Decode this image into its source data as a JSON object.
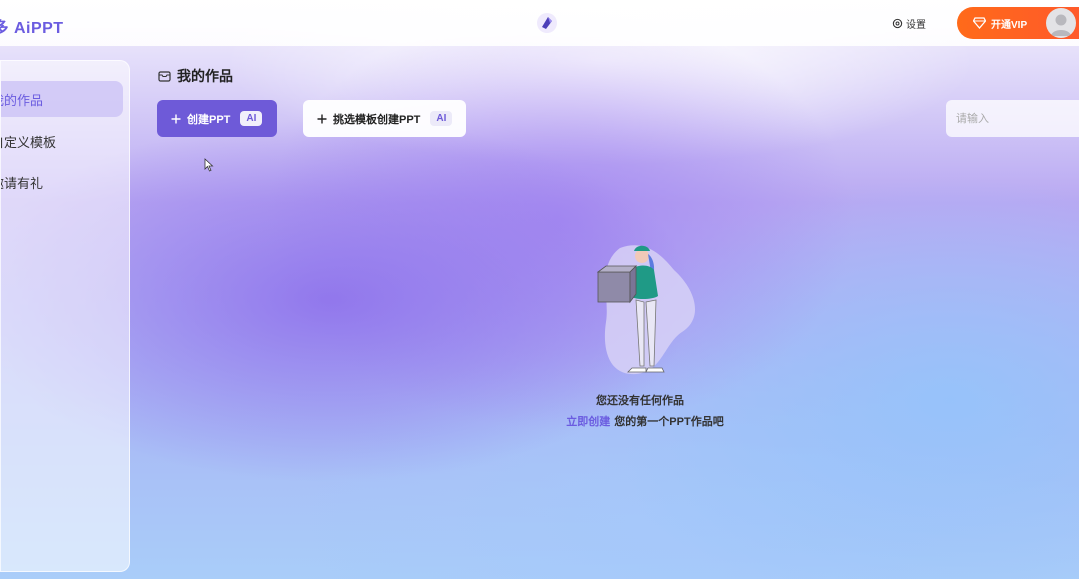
{
  "header": {
    "logo_text": "多多 AiPPT",
    "settings_label": "设置",
    "vip_label": "开通VIP"
  },
  "sidebar": {
    "items": [
      {
        "label": "我的作品",
        "active": true
      },
      {
        "label": "自定义模板",
        "active": false
      },
      {
        "label": "邀请有礼",
        "active": false
      }
    ]
  },
  "main": {
    "section_title": "我的作品",
    "create_button": {
      "label": "创建PPT",
      "badge": "AI"
    },
    "template_button": {
      "label": "挑选模板创建PPT",
      "badge": "AI"
    },
    "search": {
      "placeholder": "请输入"
    },
    "empty": {
      "title": "您还没有任何作品",
      "link_text": "立即创建",
      "suffix": "您的第一个PPT作品吧"
    }
  },
  "colors": {
    "accent": "#6e5ad8",
    "vip": "#ff6a1a"
  }
}
